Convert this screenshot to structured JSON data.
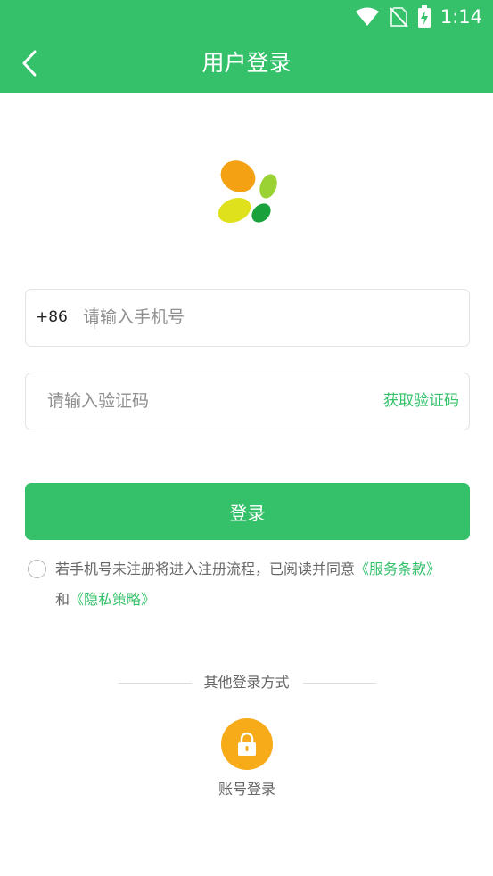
{
  "status_bar": {
    "time": "1:14"
  },
  "header": {
    "title": "用户登录"
  },
  "phone": {
    "prefix": "+86",
    "placeholder": "请输入手机号"
  },
  "code": {
    "placeholder": "请输入验证码",
    "get_code_label": "获取验证码"
  },
  "login_button": "登录",
  "agreement": {
    "text_before": "若手机号未注册将进入注册流程，已阅读并同意",
    "service_terms": "《服务条款》",
    "and": "和",
    "privacy_policy": "《隐私策略》"
  },
  "other_login": {
    "title": "其他登录方式",
    "account_label": "账号登录",
    "icon": "lock-icon"
  },
  "colors": {
    "brand_green": "#35c16a",
    "lock_orange": "#f7ab19"
  }
}
